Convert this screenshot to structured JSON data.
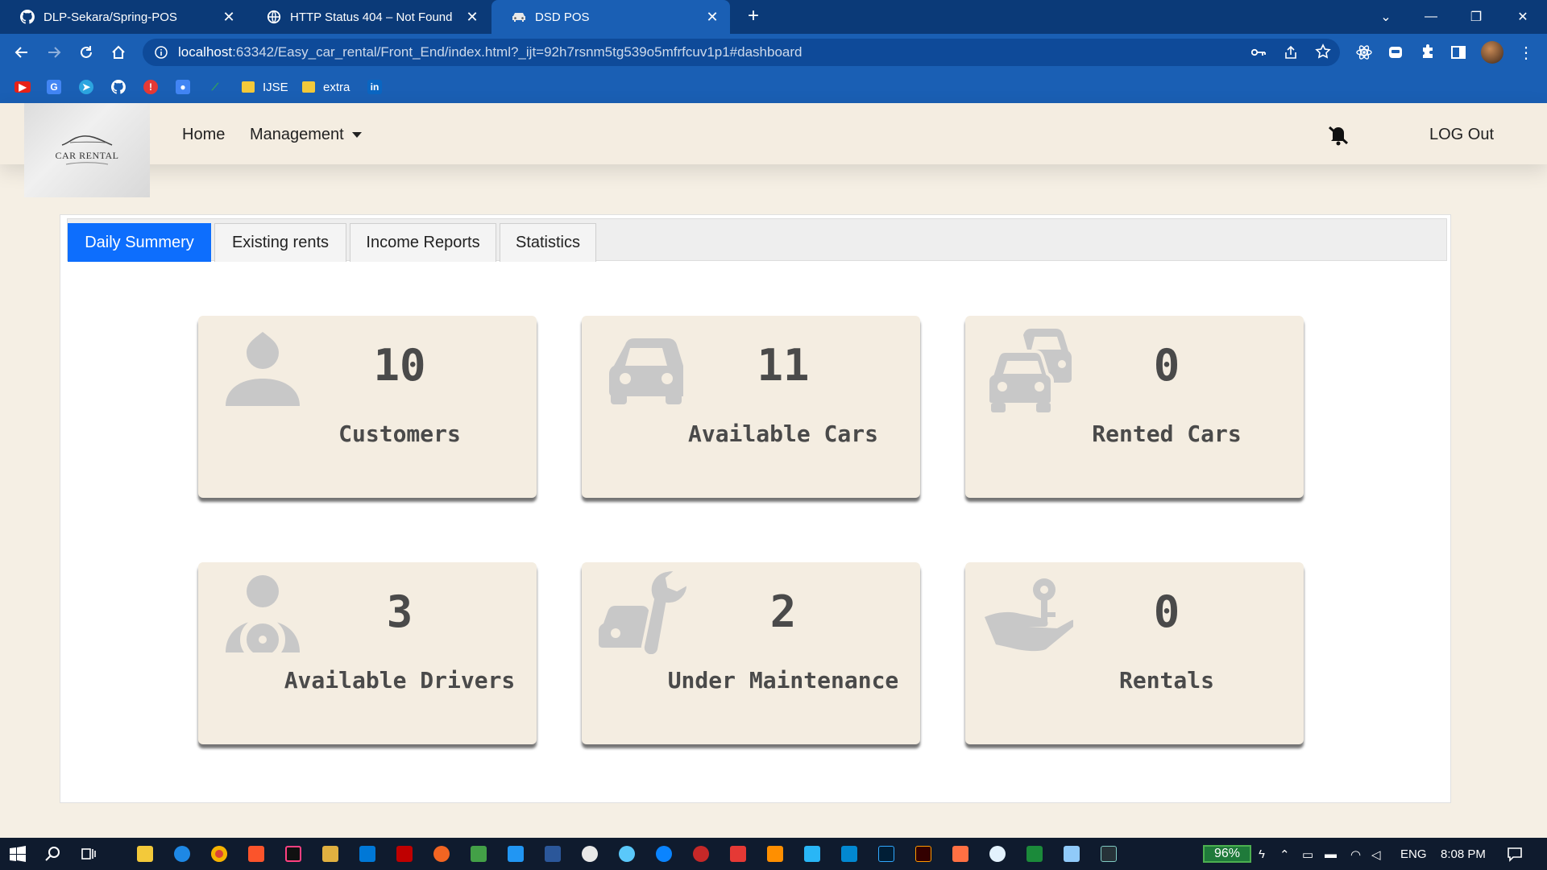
{
  "browser": {
    "tabs": [
      {
        "title": "DLP-Sekara/Spring-POS",
        "icon": "github-icon"
      },
      {
        "title": "HTTP Status 404 – Not Found",
        "icon": "globe-icon"
      },
      {
        "title": "DSD POS",
        "icon": "car-icon"
      }
    ],
    "url_host": "localhost",
    "url_path": ":63342/Easy_car_rental/Front_End/index.html?_ijt=92h7rsnm5tg539o5mfrfcuv1p1#dashboard",
    "bookmarks": [
      {
        "label": "",
        "icon": "youtube-icon",
        "color": "#e62117"
      },
      {
        "label": "",
        "icon": "translate-icon",
        "color": "#4285f4"
      },
      {
        "label": "",
        "icon": "telegram-icon",
        "color": "#2ca5e0"
      },
      {
        "label": "",
        "icon": "github-icon",
        "color": "#ffffff"
      },
      {
        "label": "",
        "icon": "alert-icon",
        "color": "#e53935"
      },
      {
        "label": "",
        "icon": "contacts-icon",
        "color": "#4285f4"
      },
      {
        "label": "",
        "icon": "link-icon",
        "color": "#34a853"
      },
      {
        "label": "IJSE",
        "icon": "folder-icon",
        "color": "#f3c93a"
      },
      {
        "label": "extra",
        "icon": "folder-icon",
        "color": "#f3c93a"
      },
      {
        "label": "in",
        "icon": "linkedin-icon",
        "color": "#0a66c2"
      }
    ]
  },
  "app": {
    "logo_text": "CAR RENTAL",
    "nav": {
      "home": "Home",
      "management": "Management",
      "notification_count": "0",
      "logout": "LOG Out"
    },
    "tabs": [
      "Daily Summery",
      "Existing rents",
      "Income Reports",
      "Statistics"
    ],
    "active_tab": "Daily Summery",
    "cards": [
      {
        "value": "10",
        "label": "Customers",
        "icon": "user-icon"
      },
      {
        "value": "11",
        "label": "Available Cars",
        "icon": "car-icon"
      },
      {
        "value": "0",
        "label": "Rented Cars",
        "icon": "cars-icon"
      },
      {
        "value": "3",
        "label": "Available Drivers",
        "icon": "driver-icon"
      },
      {
        "value": "2",
        "label": "Under Maintenance",
        "icon": "car-wrench-icon"
      },
      {
        "value": "0",
        "label": "Rentals",
        "icon": "hand-key-icon"
      }
    ]
  },
  "taskbar": {
    "battery": "96%",
    "language": "ENG",
    "time": "8:08 PM"
  },
  "colors": {
    "chrome_dark": "#0b3a78",
    "chrome": "#1a5fb4",
    "page_bg": "#f5efe4",
    "card_bg": "#f4ede1",
    "active_tab": "#0d6efd",
    "icon_gray": "#c8c8c8",
    "text_dark": "#4a4a4a"
  }
}
